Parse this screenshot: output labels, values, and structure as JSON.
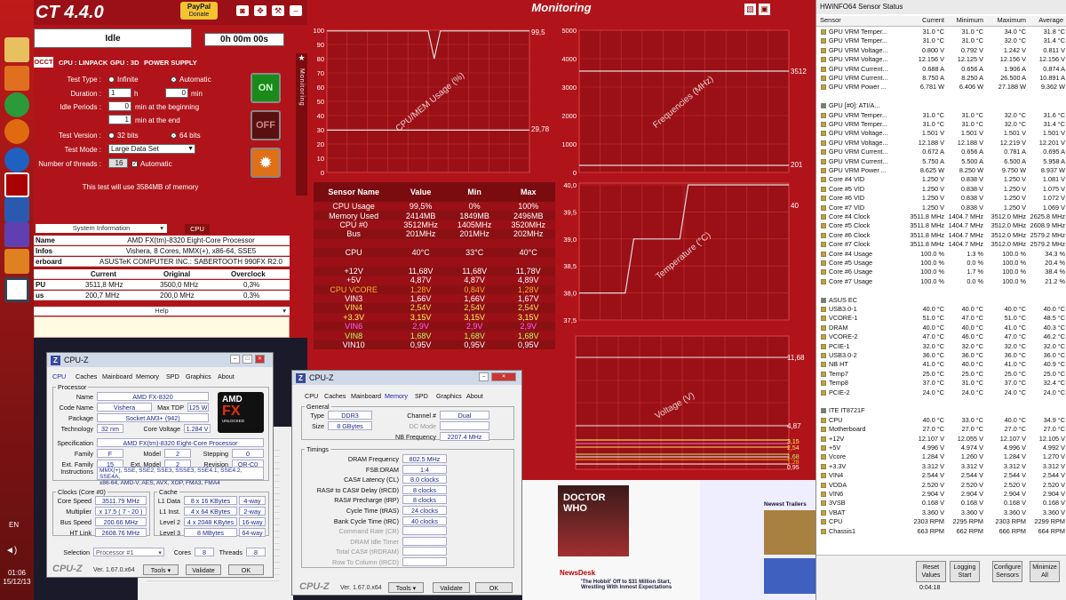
{
  "occt": {
    "title": "CT 4.4.0",
    "paypal": "PayPal",
    "paypal_sub": "Donate",
    "status": "Idle",
    "elapsed": "0h 00m 00s",
    "tabs": [
      "OCCT",
      "CPU : LINPACK",
      "GPU : 3D",
      "POWER SUPPLY"
    ],
    "test_type_label": "Test Type :",
    "opt_infinite": "Infinite",
    "opt_automatic": "Automatic",
    "duration_label": "Duration :",
    "duration_h": "1",
    "h": "h",
    "duration_m": "0",
    "min": "min",
    "idle_label": "Idle Periods :",
    "idle_begin": "0",
    "idle_begin_txt": "min at the beginning",
    "idle_end": "1",
    "idle_end_txt": "min at the end",
    "test_version_label": "Test Version :",
    "opt_32": "32 bits",
    "opt_64": "64 bits",
    "test_mode_label": "Test Mode :",
    "test_mode": "Large Data Set",
    "threads_label": "Number of threads :",
    "threads": "16",
    "threads_auto": "Automatic",
    "on": "ON",
    "off": "OFF",
    "info": "This test will use 3584MB of memory",
    "sysinfo": "System Information",
    "cpu_tab": "CPU",
    "rows": [
      {
        "l": "Name",
        "v": "AMD FX(tm)-8320 Eight-Core Processor"
      },
      {
        "l": "Infos",
        "v": "Vishera, 8 Cores, MMX(+), x86-64, SSE5"
      },
      {
        "l": "erboard",
        "v": "ASUSTeK COMPUTER INC.: SABERTOOTH 990FX R2.0"
      }
    ],
    "clock_head": [
      "Current",
      "Original",
      "Overclock"
    ],
    "clock_rows": [
      {
        "l": "PU",
        "c": "3511,8 MHz",
        "o": "3500,0 MHz",
        "x": "0,3%"
      },
      {
        "l": "us",
        "c": "200,7 MHz",
        "o": "200,0 MHz",
        "x": "0,3%"
      }
    ],
    "help": "Help",
    "side": "Monitoring"
  },
  "taskbar": {
    "lang": "EN",
    "time": "01:06",
    "date": "15/12/13"
  },
  "mon": {
    "title": "Monitoring",
    "plot1": {
      "ylabel": "CPU/MEM Usage (%)",
      "yticks": [
        "100",
        "90",
        "80",
        "70",
        "60",
        "50",
        "40",
        "30",
        "20",
        "10",
        "0"
      ],
      "r1": "99,5",
      "r2": "29,78"
    },
    "plot2": {
      "ylabel": "Frequencies (MHz)",
      "yticks": [
        "5000",
        "4000",
        "3000",
        "2000",
        "1000",
        "0"
      ],
      "r1": "3512",
      "r2": "201"
    },
    "plot3": {
      "ylabel": "Temperature (°C)",
      "yticks": [
        "40,0",
        "39,5",
        "39,0",
        "38,5",
        "38,0",
        "37,5"
      ],
      "r1": "40"
    },
    "plot4": {
      "ylabel": "Voltage (V)",
      "r1": "11,68",
      "r2": "4,87",
      "r3": "3,15",
      "r4": "2,54",
      "r5": "1,68",
      "r6": "1,28",
      "r7": "0,95"
    },
    "table": {
      "head": [
        "Sensor Name",
        "Value",
        "Min",
        "Max"
      ],
      "rows": [
        {
          "n": "CPU Usage",
          "v": "99,5%",
          "mi": "0%",
          "ma": "100%",
          "c": "#fff"
        },
        {
          "n": "Memory Used",
          "v": "2414MB",
          "mi": "1849MB",
          "ma": "2496MB",
          "c": "#fff"
        },
        {
          "n": "CPU #0",
          "v": "3512MHz",
          "mi": "1405MHz",
          "ma": "3520MHz",
          "c": "#fff"
        },
        {
          "n": "Bus",
          "v": "201MHz",
          "mi": "201MHz",
          "ma": "202MHz",
          "c": "#fff"
        },
        {
          "n": "",
          "v": "",
          "mi": "",
          "ma": "",
          "c": "#fff"
        },
        {
          "n": "CPU",
          "v": "40°C",
          "mi": "33°C",
          "ma": "40°C",
          "c": "#fff"
        },
        {
          "n": "",
          "v": "",
          "mi": "",
          "ma": "",
          "c": "#fff"
        },
        {
          "n": "+12V",
          "v": "11,68V",
          "mi": "11,68V",
          "ma": "11,78V",
          "c": "#fff"
        },
        {
          "n": "+5V",
          "v": "4,87V",
          "mi": "4,87V",
          "ma": "4,89V",
          "c": "#fff"
        },
        {
          "n": "CPU VCORE",
          "v": "1,28V",
          "mi": "0,84V",
          "ma": "1,28V",
          "c": "#ffb020"
        },
        {
          "n": "VIN3",
          "v": "1,66V",
          "mi": "1,66V",
          "ma": "1,67V",
          "c": "#fff"
        },
        {
          "n": "VIN4",
          "v": "2,54V",
          "mi": "2,54V",
          "ma": "2,54V",
          "c": "#ffe060"
        },
        {
          "n": "+3.3V",
          "v": "3,15V",
          "mi": "3,15V",
          "ma": "3,15V",
          "c": "#ffff60"
        },
        {
          "n": "VIN6",
          "v": "2,9V",
          "mi": "2,9V",
          "ma": "2,9V",
          "c": "#ff60ff"
        },
        {
          "n": "VIN8",
          "v": "1,68V",
          "mi": "1,68V",
          "ma": "1,68V",
          "c": "#b0ff60"
        },
        {
          "n": "VIN10",
          "v": "0,95V",
          "mi": "0,95V",
          "ma": "0,95V",
          "c": "#fff"
        }
      ]
    }
  },
  "hw": {
    "title": "HWiNFO64 Sensor Status",
    "head": [
      "Sensor",
      "Current",
      "Minimum",
      "Maximum",
      "Average"
    ],
    "rows": [
      [
        "GPU VRM Temper...",
        "31.0 °C",
        "31.0 °C",
        "34.0 °C",
        "31.8 °C"
      ],
      [
        "GPU VRM Temper...",
        "31.0 °C",
        "31.0 °C",
        "32.0 °C",
        "31.4 °C"
      ],
      [
        "GPU VRM Voltage...",
        "0.800 V",
        "0.792 V",
        "1.242 V",
        "0.811 V"
      ],
      [
        "GPU VRM Voltage...",
        "12.156 V",
        "12.125 V",
        "12.156 V",
        "12.156 V"
      ],
      [
        "GPU VRM Current...",
        "0.688 A",
        "0.656 A",
        "1.906 A",
        "0.874 A"
      ],
      [
        "GPU VRM Current...",
        "8.750 A",
        "8.250 A",
        "26.500 A",
        "10.891 A"
      ],
      [
        "GPU VRM Power ...",
        "6.781 W",
        "6.406 W",
        "27.188 W",
        "9.362 W"
      ],
      [
        "",
        "",
        "",
        "",
        ""
      ],
      [
        "GPU [#0]: ATI/A...",
        "",
        "",
        "",
        ""
      ],
      [
        "GPU VRM Temper...",
        "31.0 °C",
        "31.0 °C",
        "32.0 °C",
        "31.6 °C"
      ],
      [
        "GPU VRM Temper...",
        "31.0 °C",
        "31.0 °C",
        "32.0 °C",
        "31.4 °C"
      ],
      [
        "GPU VRM Voltage...",
        "1.501 V",
        "1.501 V",
        "1.501 V",
        "1.501 V"
      ],
      [
        "GPU VRM Voltage...",
        "12.188 V",
        "12.188 V",
        "12.219 V",
        "12.201 V"
      ],
      [
        "GPU VRM Current...",
        "0.672 A",
        "0.656 A",
        "0.781 A",
        "0.695 A"
      ],
      [
        "GPU VRM Current...",
        "5.750 A",
        "5.500 A",
        "6.500 A",
        "5.958 A"
      ],
      [
        "GPU VRM Power ...",
        "8.625 W",
        "8.250 W",
        "9.750 W",
        "8.937 W"
      ],
      [
        "Core #4 VID",
        "1.250 V",
        "0.838 V",
        "1.250 V",
        "1.081 V"
      ],
      [
        "Core #5 VID",
        "1.250 V",
        "0.838 V",
        "1.250 V",
        "1.075 V"
      ],
      [
        "Core #6 VID",
        "1.250 V",
        "0.838 V",
        "1.250 V",
        "1.072 V"
      ],
      [
        "Core #7 VID",
        "1.250 V",
        "0.838 V",
        "1.250 V",
        "1.069 V"
      ],
      [
        "Core #4 Clock",
        "3511.8 MHz",
        "1404.7 MHz",
        "3512.0 MHz",
        "2625.8 MHz"
      ],
      [
        "Core #5 Clock",
        "3511.8 MHz",
        "1404.7 MHz",
        "3512.0 MHz",
        "2608.9 MHz"
      ],
      [
        "Core #6 Clock",
        "3511.8 MHz",
        "1404.7 MHz",
        "3512.0 MHz",
        "2579.2 MHz"
      ],
      [
        "Core #7 Clock",
        "3511.8 MHz",
        "1404.7 MHz",
        "3512.0 MHz",
        "2579.2 MHz"
      ],
      [
        "Core #4 Usage",
        "100.0 %",
        "1.3 %",
        "100.0 %",
        "34.3 %"
      ],
      [
        "Core #5 Usage",
        "100.0 %",
        "0.0 %",
        "100.0 %",
        "20.4 %"
      ],
      [
        "Core #6 Usage",
        "100.0 %",
        "1.7 %",
        "100.0 %",
        "38.4 %"
      ],
      [
        "Core #7 Usage",
        "100.0 %",
        "0.0 %",
        "100.0 %",
        "21.2 %"
      ],
      [
        "",
        "",
        "",
        "",
        ""
      ],
      [
        "ASUS EC",
        "",
        "",
        "",
        ""
      ],
      [
        "USB3.0-1",
        "40.0 °C",
        "40.0 °C",
        "40.0 °C",
        "40.0 °C"
      ],
      [
        "VCORE-1",
        "51.0 °C",
        "47.0 °C",
        "51.0 °C",
        "48.5 °C"
      ],
      [
        "DRAM",
        "40.0 °C",
        "40.0 °C",
        "41.0 °C",
        "40.3 °C"
      ],
      [
        "VCORE-2",
        "47.0 °C",
        "46.0 °C",
        "47.0 °C",
        "46.2 °C"
      ],
      [
        "PCIE-1",
        "32.0 °C",
        "32.0 °C",
        "32.0 °C",
        "32.0 °C"
      ],
      [
        "USB3.0-2",
        "36.0 °C",
        "36.0 °C",
        "36.0 °C",
        "36.0 °C"
      ],
      [
        "NB HT",
        "41.0 °C",
        "40.0 °C",
        "41.0 °C",
        "40.9 °C"
      ],
      [
        "Temp7",
        "25.0 °C",
        "25.0 °C",
        "25.0 °C",
        "25.0 °C"
      ],
      [
        "Temp8",
        "37.0 °C",
        "31.0 °C",
        "37.0 °C",
        "32.4 °C"
      ],
      [
        "PCIE-2",
        "24.0 °C",
        "24.0 °C",
        "24.0 °C",
        "24.0 °C"
      ],
      [
        "",
        "",
        "",
        "",
        ""
      ],
      [
        "ITE IT8721F",
        "",
        "",
        "",
        ""
      ],
      [
        "CPU",
        "40.0 °C",
        "33.0 °C",
        "40.0 °C",
        "34.9 °C"
      ],
      [
        "Motherboard",
        "27.0 °C",
        "27.0 °C",
        "27.0 °C",
        "27.0 °C"
      ],
      [
        "+12V",
        "12.107 V",
        "12.055 V",
        "12.107 V",
        "12.105 V"
      ],
      [
        "+5V",
        "4.996 V",
        "4.974 V",
        "4.996 V",
        "4.992 V"
      ],
      [
        "Vcore",
        "1.284 V",
        "1.260 V",
        "1.284 V",
        "1.270 V"
      ],
      [
        "+3.3V",
        "3.312 V",
        "3.312 V",
        "3.312 V",
        "3.312 V"
      ],
      [
        "VIN4",
        "2.544 V",
        "2.544 V",
        "2.544 V",
        "2.544 V"
      ],
      [
        "VDDA",
        "2.520 V",
        "2.520 V",
        "2.520 V",
        "2.520 V"
      ],
      [
        "VIN6",
        "2.904 V",
        "2.904 V",
        "2.904 V",
        "2.904 V"
      ],
      [
        "3VSB",
        "0.168 V",
        "0.168 V",
        "0.168 V",
        "0.168 V"
      ],
      [
        "VBAT",
        "3.360 V",
        "3.360 V",
        "3.360 V",
        "3.360 V"
      ],
      [
        "CPU",
        "2303 RPM",
        "2295 RPM",
        "2303 RPM",
        "2299 RPM"
      ],
      [
        "Chassis1",
        "663 RPM",
        "662 RPM",
        "666 RPM",
        "664 RPM"
      ]
    ],
    "btns": [
      "Reset Values",
      "Logging Start",
      "Configure Sensors",
      "Minimize All"
    ],
    "elapsed": "0:04:18"
  },
  "cpuz1": {
    "title": "CPU-Z",
    "tabs": [
      "CPU",
      "Caches",
      "Mainboard",
      "Memory",
      "SPD",
      "Graphics",
      "About"
    ],
    "processor": "Processor",
    "name_l": "Name",
    "name": "AMD FX-8320",
    "code_l": "Code Name",
    "code": "Vishera",
    "tdp_l": "Max TDP",
    "tdp": "125 W",
    "pkg_l": "Package",
    "pkg": "Socket AM3+ (942)",
    "tech_l": "Technology",
    "tech": "32 nm",
    "cv_l": "Core Voltage",
    "cv": "1.284 V",
    "spec_l": "Specification",
    "spec": "AMD FX(tm)-8320 Eight-Core Processor",
    "fam_l": "Family",
    "fam": "F",
    "model_l": "Model",
    "model": "2",
    "step_l": "Stepping",
    "step": "0",
    "efam_l": "Ext. Family",
    "efam": "15",
    "emod_l": "Ext. Model",
    "emod": "2",
    "rev_l": "Revision",
    "rev": "OR-C0",
    "instr_l": "Instructions",
    "instr1": "MMX(+), SSE, SSE2, SSE3, SSSE3, SSE4.1, SSE4.2, SSE4A,",
    "instr2": "x86-64, AMD-V, AES, AVX, XOP, FMA3, FMA4",
    "clocks": "Clocks (Core #0)",
    "cs_l": "Core Speed",
    "cs": "3511.79 MHz",
    "mult_l": "Multiplier",
    "mult": "x 17.5 ( 7 - 20 )",
    "bus_l": "Bus Speed",
    "bus": "200.66 MHz",
    "ht_l": "HT Link",
    "ht": "2608.76 MHz",
    "cache": "Cache",
    "l1d_l": "L1 Data",
    "l1d": "8 x 16 KBytes",
    "l1d_w": "4-way",
    "l1i_l": "L1 Inst.",
    "l1i": "4 x 64 KBytes",
    "l1i_w": "2-way",
    "l2_l": "Level 2",
    "l2": "4 x 2048 KBytes",
    "l2_w": "16-way",
    "l3_l": "Level 3",
    "l3": "8 MBytes",
    "l3_w": "64-way",
    "sel_l": "Selection",
    "sel": "Processor #1",
    "cores_l": "Cores",
    "cores": "8",
    "thr_l": "Threads",
    "thr": "8",
    "brand": "CPU-Z",
    "ver": "Ver. 1.67.0.x64",
    "tools": "Tools",
    "validate": "Validate",
    "ok": "OK",
    "amd": "AMD",
    "fx": "FX",
    "unlocked": "UNLOCKED"
  },
  "cpuz2": {
    "title": "CPU-Z",
    "tabs": [
      "CPU",
      "Caches",
      "Mainboard",
      "Memory",
      "SPD",
      "Graphics",
      "About"
    ],
    "general": "General",
    "type_l": "Type",
    "type": "DDR3",
    "chan_l": "Channel #",
    "chan": "Dual",
    "size_l": "Size",
    "size": "8 GBytes",
    "dc_l": "DC Mode",
    "nbf_l": "NB Frequency",
    "nbf": "2207.4 MHz",
    "timings": "Timings",
    "rows": [
      {
        "l": "DRAM Frequency",
        "v": "802.5 MHz"
      },
      {
        "l": "FSB:DRAM",
        "v": "1:4"
      },
      {
        "l": "CAS# Latency (CL)",
        "v": "8.0 clocks"
      },
      {
        "l": "RAS# to CAS# Delay (tRCD)",
        "v": "8 clocks"
      },
      {
        "l": "RAS# Precharge (tRP)",
        "v": "8 clocks"
      },
      {
        "l": "Cycle Time (tRAS)",
        "v": "24 clocks"
      },
      {
        "l": "Bank Cycle Time (tRC)",
        "v": "40 clocks"
      },
      {
        "l": "Command Rate (CR)",
        "v": ""
      },
      {
        "l": "DRAM Idle Timer",
        "v": ""
      },
      {
        "l": "Total CAS# (tRDRAM)",
        "v": ""
      },
      {
        "l": "Row To Column (tRCD)",
        "v": ""
      }
    ],
    "brand": "CPU-Z",
    "ver": "Ver. 1.67.0.x64",
    "tools": "Tools",
    "validate": "Validate",
    "ok": "OK"
  },
  "web": {
    "doctor": "DOCTOR",
    "who": "WHO",
    "newsdesk": "NewsDesk",
    "headline": "'The Hobbit' Off to $31 Million Start, Wrestling With Inmost Expectations",
    "trailers": "Newest Trailers"
  }
}
